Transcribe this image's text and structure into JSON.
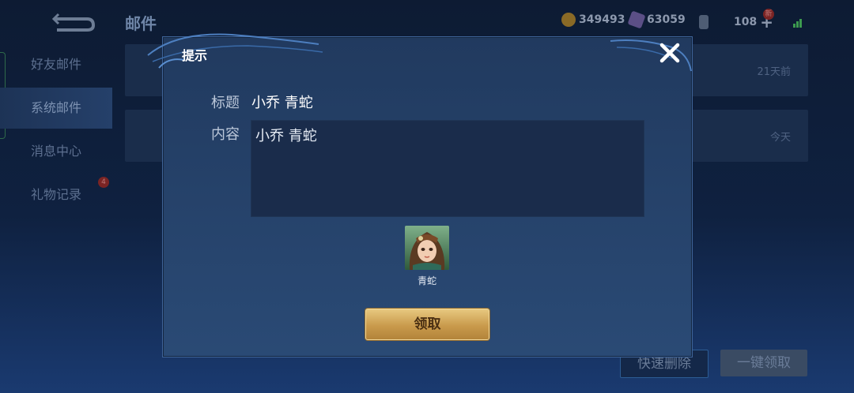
{
  "header": {
    "title": "邮件",
    "gold": "349493",
    "gems": "63059",
    "energy": "108",
    "energy_badge": "新"
  },
  "sidebar": {
    "items": [
      {
        "label": "好友邮件"
      },
      {
        "label": "系统邮件"
      },
      {
        "label": "消息中心"
      },
      {
        "label": "礼物记录",
        "badge": "4"
      }
    ]
  },
  "mail_list": [
    {
      "time": "21天前"
    },
    {
      "time": "今天"
    }
  ],
  "bottom_actions": {
    "quick_delete": "快速删除",
    "claim_all": "一键领取"
  },
  "dialog": {
    "title": "提示",
    "subject_label": "标题",
    "subject": "小乔 青蛇",
    "content_label": "内容",
    "content": "小乔 青蛇",
    "reward_name": "青蛇",
    "claim_label": "领取"
  },
  "colors": {
    "dialog_bg": "#2a4a75",
    "claim_gold": "#c99a4c",
    "close_x": "#ffffff"
  }
}
